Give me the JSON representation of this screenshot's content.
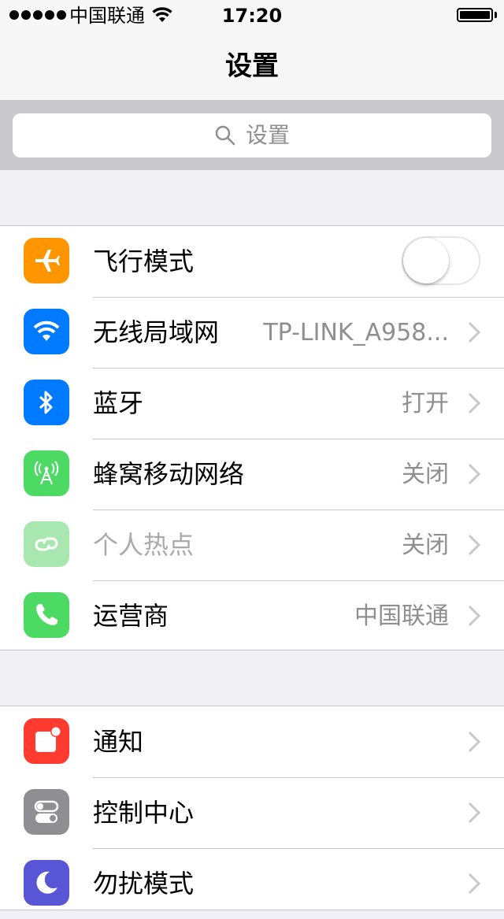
{
  "status_bar": {
    "carrier": "中国联通",
    "time": "17:20",
    "signal_bars": 5,
    "battery_level": 1.0
  },
  "nav": {
    "title": "设置"
  },
  "search": {
    "placeholder": "设置",
    "icon": "search-icon"
  },
  "colors": {
    "airplane": "#ff9500",
    "wifi": "#007aff",
    "bluetooth": "#007aff",
    "cellular": "#4cd964",
    "hotspot": "#a8e8b0",
    "carrier": "#4cd964",
    "notifications": "#ff3b30",
    "control_center": "#8e8e93",
    "do_not_disturb": "#5856d6"
  },
  "group1": {
    "airplane": {
      "label": "飞行模式",
      "icon": "airplane-icon",
      "toggle_on": false
    },
    "wifi": {
      "label": "无线局域网",
      "value": "TP-LINK_A958...",
      "icon": "wifi-icon"
    },
    "bluetooth": {
      "label": "蓝牙",
      "value": "打开",
      "icon": "bluetooth-icon"
    },
    "cellular": {
      "label": "蜂窝移动网络",
      "value": "关闭",
      "icon": "cellular-icon"
    },
    "hotspot": {
      "label": "个人热点",
      "value": "关闭",
      "icon": "hotspot-icon"
    },
    "carrier": {
      "label": "运营商",
      "value": "中国联通",
      "icon": "phone-icon"
    }
  },
  "group2": {
    "notifications": {
      "label": "通知",
      "icon": "notifications-icon"
    },
    "control_center": {
      "label": "控制中心",
      "icon": "control-center-icon"
    },
    "do_not_disturb": {
      "label": "勿扰模式",
      "icon": "moon-icon"
    }
  }
}
